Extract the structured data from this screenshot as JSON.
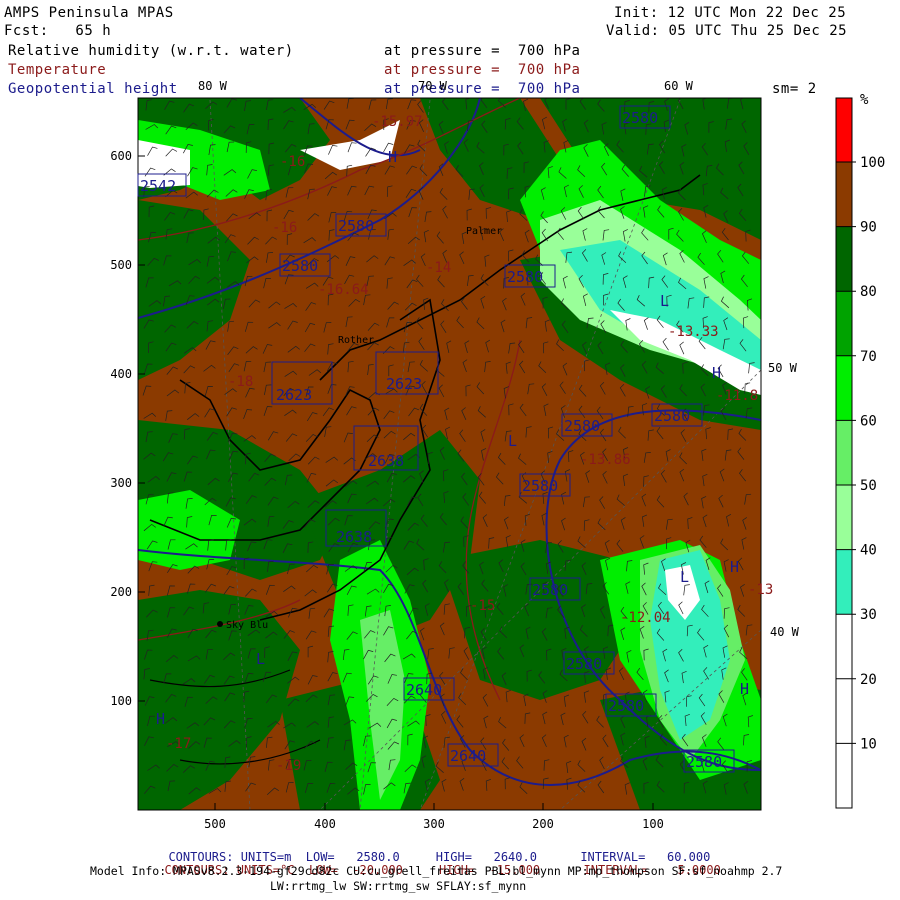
{
  "header": {
    "model": "AMPS Peninsula MPAS",
    "fcst": "Fcst:   65 h",
    "init": "Init: 12 UTC Mon 22 Dec 25",
    "valid": "Valid: 05 UTC Thu 25 Dec 25"
  },
  "fields": [
    {
      "name": "Relative humidity (w.r.t. water)",
      "level": "at pressure =  700 hPa",
      "color": "#000000"
    },
    {
      "name": "Temperature",
      "level": "at pressure =  700 hPa",
      "color": "#8b1a1a"
    },
    {
      "name": "Geopotential height",
      "level": "at pressure =  700 hPa",
      "color": "#1c1c8c"
    }
  ],
  "smoothing": "sm= 2",
  "map": {
    "y_ticks": [
      "600",
      "500",
      "400",
      "300",
      "200",
      "100"
    ],
    "x_ticks": [
      "500",
      "400",
      "300",
      "200",
      "100"
    ],
    "lon_labels": [
      "80 W",
      "70 W",
      "60 W",
      "50 W",
      "40 W"
    ],
    "place_labels": [
      "Palmer",
      "Rother",
      "Sky Blu"
    ],
    "height_labels": [
      "2542",
      "2580",
      "2580",
      "2580",
      "2580",
      "2580",
      "2580",
      "2580",
      "2580",
      "2580",
      "2580",
      "2580",
      "2623",
      "2623",
      "2638",
      "2638",
      "2640",
      "2640"
    ],
    "temp_labels": [
      "-16",
      "-16",
      "-15",
      "-14",
      "-13",
      "-13.33",
      "-11.8",
      "-13.86",
      "-12.04",
      "-17",
      "-18",
      "-19",
      "-16.64",
      "-15.97"
    ],
    "pressure_marks": [
      "H",
      "H",
      "H",
      "H",
      "H",
      "L",
      "L",
      "L",
      "L"
    ]
  },
  "colorbar": {
    "unit": "%",
    "levels": [
      "100",
      "90",
      "80",
      "70",
      "60",
      "50",
      "40",
      "30",
      "20",
      "10"
    ],
    "colors": [
      "#ff0000",
      "#8b3a00",
      "#006600",
      "#00a300",
      "#00ee00",
      "#66ee66",
      "#99ff99",
      "#33eebb",
      "#ffffff",
      "#ffffff",
      "#ffffff"
    ]
  },
  "footer": {
    "contours1": {
      "label": "CONTOURS:",
      "units": "UNITS=m",
      "low": "LOW=   2580.0",
      "high": "HIGH=   2640.0",
      "interval": "INTERVAL=   60.000",
      "color": "#1c1c8c"
    },
    "contours2": {
      "label": "CONTOURS:",
      "units": "UNITS=°C",
      "low": "LOW=  -20.000",
      "high": "HIGH=  -15.000",
      "interval": "INTERVAL=    5.0000",
      "color": "#8b1a1a"
    },
    "model_info1": "Model Info: MPASv8.2.3-194-gf29cd82c CU:cu_grell_freitas PBL:bl_mynn MP:mp_thompson SF:sf_noahmp 2.7",
    "model_info2": "LW:rrtmg_lw SW:rrtmg_sw SFLAY:sf_mynn"
  }
}
